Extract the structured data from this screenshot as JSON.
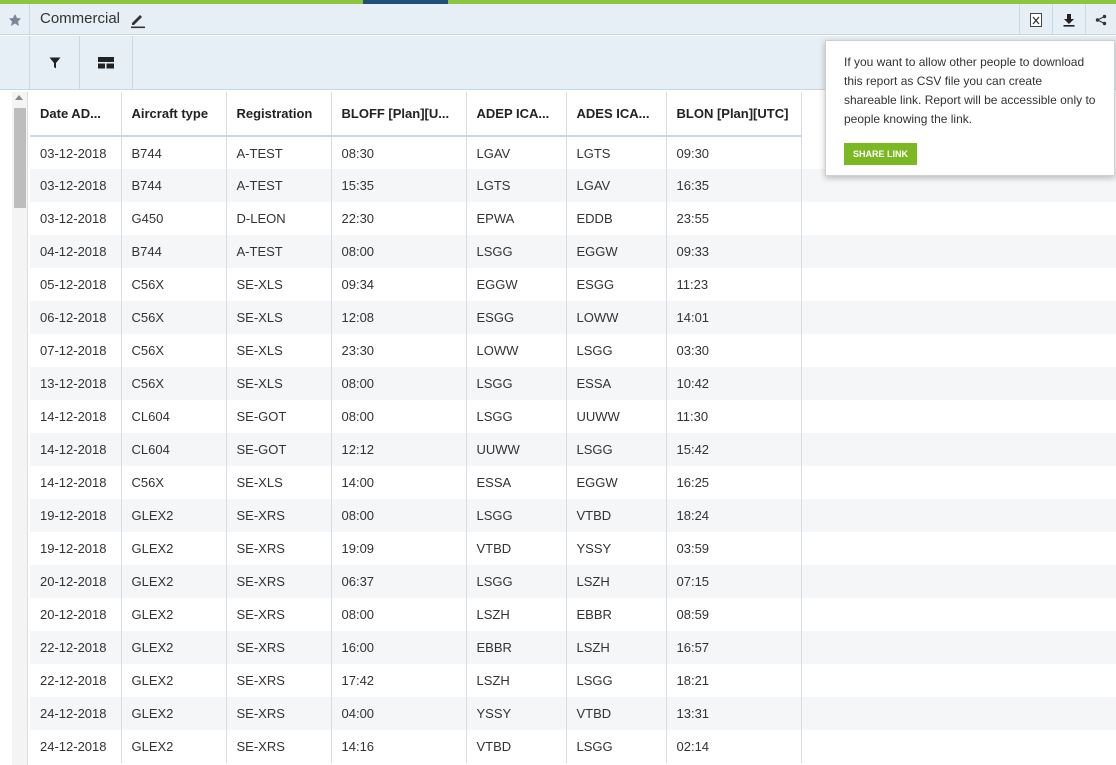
{
  "report": {
    "title": "Commercial"
  },
  "popup": {
    "message": "If you want to allow other people to download this report as CSV file you can create shareable link. Report will be accessible only to people knowing the link.",
    "share_label": "SHARE LINK"
  },
  "colors": {
    "accent": "#8cc63f",
    "accent_dark": "#1f4e79",
    "button": "#7cb823",
    "header_bg": "#e6eef6"
  },
  "icons": [
    "pin-icon",
    "edit-icon",
    "excel-icon",
    "download-icon",
    "share-icon",
    "filter-icon",
    "layout-icon"
  ],
  "table": {
    "columns": [
      "Date AD...",
      "Aircraft type",
      "Registration",
      "BLOFF [Plan][U...",
      "ADEP ICA...",
      "ADES ICA...",
      "BLON [Plan][UTC]"
    ],
    "rows": [
      [
        "03-12-2018",
        "B744",
        "A-TEST",
        "08:30",
        "LGAV",
        "LGTS",
        "09:30"
      ],
      [
        "03-12-2018",
        "B744",
        "A-TEST",
        "15:35",
        "LGTS",
        "LGAV",
        "16:35"
      ],
      [
        "03-12-2018",
        "G450",
        "D-LEON",
        "22:30",
        "EPWA",
        "EDDB",
        "23:55"
      ],
      [
        "04-12-2018",
        "B744",
        "A-TEST",
        "08:00",
        "LSGG",
        "EGGW",
        "09:33"
      ],
      [
        "05-12-2018",
        "C56X",
        "SE-XLS",
        "09:34",
        "EGGW",
        "ESGG",
        "11:23"
      ],
      [
        "06-12-2018",
        "C56X",
        "SE-XLS",
        "12:08",
        "ESGG",
        "LOWW",
        "14:01"
      ],
      [
        "07-12-2018",
        "C56X",
        "SE-XLS",
        "23:30",
        "LOWW",
        "LSGG",
        "03:30"
      ],
      [
        "13-12-2018",
        "C56X",
        "SE-XLS",
        "08:00",
        "LSGG",
        "ESSA",
        "10:42"
      ],
      [
        "14-12-2018",
        "CL604",
        "SE-GOT",
        "08:00",
        "LSGG",
        "UUWW",
        "11:30"
      ],
      [
        "14-12-2018",
        "CL604",
        "SE-GOT",
        "12:12",
        "UUWW",
        "LSGG",
        "15:42"
      ],
      [
        "14-12-2018",
        "C56X",
        "SE-XLS",
        "14:00",
        "ESSA",
        "EGGW",
        "16:25"
      ],
      [
        "19-12-2018",
        "GLEX2",
        "SE-XRS",
        "08:00",
        "LSGG",
        "VTBD",
        "18:24"
      ],
      [
        "19-12-2018",
        "GLEX2",
        "SE-XRS",
        "19:09",
        "VTBD",
        "YSSY",
        "03:59"
      ],
      [
        "20-12-2018",
        "GLEX2",
        "SE-XRS",
        "06:37",
        "LSGG",
        "LSZH",
        "07:15"
      ],
      [
        "20-12-2018",
        "GLEX2",
        "SE-XRS",
        "08:00",
        "LSZH",
        "EBBR",
        "08:59"
      ],
      [
        "22-12-2018",
        "GLEX2",
        "SE-XRS",
        "16:00",
        "EBBR",
        "LSZH",
        "16:57"
      ],
      [
        "22-12-2018",
        "GLEX2",
        "SE-XRS",
        "17:42",
        "LSZH",
        "LSGG",
        "18:21"
      ],
      [
        "24-12-2018",
        "GLEX2",
        "SE-XRS",
        "04:00",
        "YSSY",
        "VTBD",
        "13:31"
      ],
      [
        "24-12-2018",
        "GLEX2",
        "SE-XRS",
        "14:16",
        "VTBD",
        "LSGG",
        "02:14"
      ]
    ]
  }
}
